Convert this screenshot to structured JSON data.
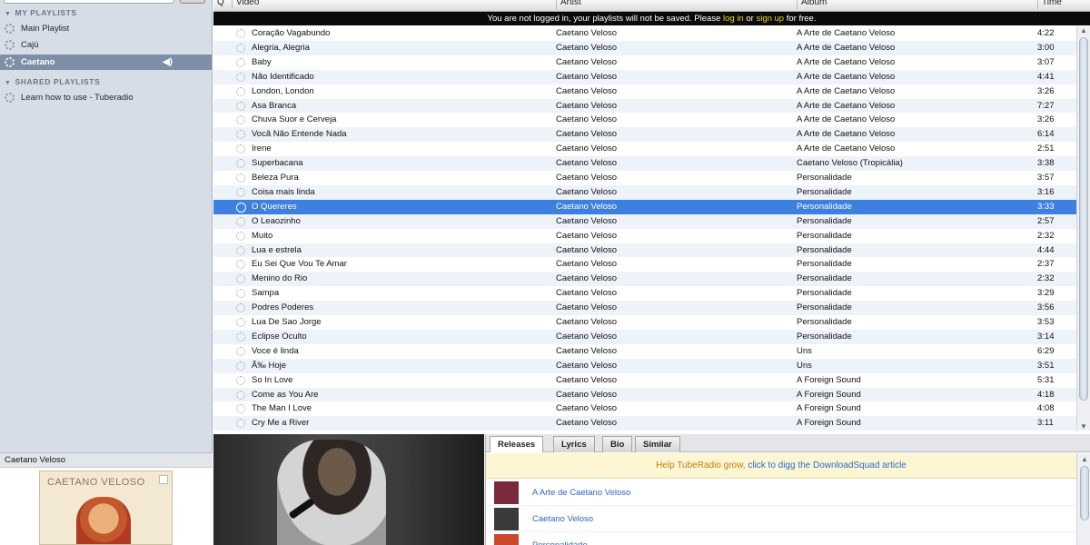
{
  "sidebar": {
    "sections": [
      {
        "label": "MY PLAYLISTS",
        "items": [
          {
            "label": "Main Playlist"
          },
          {
            "label": "Cajú"
          },
          {
            "label": "Caetano",
            "active": true
          }
        ]
      },
      {
        "label": "SHARED PLAYLISTS",
        "items": [
          {
            "label": "Learn how to use - Tuberadio"
          }
        ]
      }
    ]
  },
  "now_playing": {
    "artist": "Caetano Veloso",
    "cover_text": "CAETANO VELOSO"
  },
  "table": {
    "headers": {
      "queue": "Q",
      "video": "Video",
      "artist": "Artist",
      "album": "Album",
      "time": "Time"
    },
    "notice": {
      "prefix": "You are not logged in, your playlists will not be saved. Please ",
      "login": "log in",
      "or": " or ",
      "signup": "sign up",
      "suffix": " for free."
    },
    "rows": [
      {
        "title": "Coração Vagabundo",
        "artist": "Caetano Veloso",
        "album": "A Arte de Caetano Veloso",
        "time": "4:22"
      },
      {
        "title": "Alegria, Alegria",
        "artist": "Caetano Veloso",
        "album": "A Arte de Caetano Veloso",
        "time": "3:00"
      },
      {
        "title": "Baby",
        "artist": "Caetano Veloso",
        "album": "A Arte de Caetano Veloso",
        "time": "3:07"
      },
      {
        "title": "Não Identificado",
        "artist": "Caetano Veloso",
        "album": "A Arte de Caetano Veloso",
        "time": "4:41"
      },
      {
        "title": "London, London",
        "artist": "Caetano Veloso",
        "album": "A Arte de Caetano Veloso",
        "time": "3:26"
      },
      {
        "title": "Asa Branca",
        "artist": "Caetano Veloso",
        "album": "A Arte de Caetano Veloso",
        "time": "7:27"
      },
      {
        "title": "Chuva Suor e Cerveja",
        "artist": "Caetano Veloso",
        "album": "A Arte de Caetano Veloso",
        "time": "3:26"
      },
      {
        "title": "Vocã Não Entende Nada",
        "artist": "Caetano Veloso",
        "album": "A Arte de Caetano Veloso",
        "time": "6:14"
      },
      {
        "title": "Irene",
        "artist": "Caetano Veloso",
        "album": "A Arte de Caetano Veloso",
        "time": "2:51"
      },
      {
        "title": "Superbacana",
        "artist": "Caetano Veloso",
        "album": "Caetano Veloso (Tropicália)",
        "time": "3:38"
      },
      {
        "title": "Beleza Pura",
        "artist": "Caetano Veloso",
        "album": "Personalidade",
        "time": "3:57"
      },
      {
        "title": "Coisa mais linda",
        "artist": "Caetano Veloso",
        "album": "Personalidade",
        "time": "3:16"
      },
      {
        "title": "O Quereres",
        "artist": "Caetano Veloso",
        "album": "Personalidade",
        "time": "3:33",
        "selected": true
      },
      {
        "title": "O Leaozinho",
        "artist": "Caetano Veloso",
        "album": "Personalidade",
        "time": "2:57"
      },
      {
        "title": "Muito",
        "artist": "Caetano Veloso",
        "album": "Personalidade",
        "time": "2:32"
      },
      {
        "title": "Lua e estrela",
        "artist": "Caetano Veloso",
        "album": "Personalidade",
        "time": "4:44"
      },
      {
        "title": "Eu Sei Que Vou Te Amar",
        "artist": "Caetano Veloso",
        "album": "Personalidade",
        "time": "2:37"
      },
      {
        "title": "Menino do Rio",
        "artist": "Caetano Veloso",
        "album": "Personalidade",
        "time": "2:32"
      },
      {
        "title": "Sampa",
        "artist": "Caetano Veloso",
        "album": "Personalidade",
        "time": "3:29"
      },
      {
        "title": "Podres Poderes",
        "artist": "Caetano Veloso",
        "album": "Personalidade",
        "time": "3:56"
      },
      {
        "title": "Lua De Sao Jorge",
        "artist": "Caetano Veloso",
        "album": "Personalidade",
        "time": "3:53"
      },
      {
        "title": "Eclipse Oculto",
        "artist": "Caetano Veloso",
        "album": "Personalidade",
        "time": "3:14"
      },
      {
        "title": "Voce é linda",
        "artist": "Caetano Veloso",
        "album": "Uns",
        "time": "6:29"
      },
      {
        "title": "Ã‰ Hoje",
        "artist": "Caetano Veloso",
        "album": "Uns",
        "time": "3:51"
      },
      {
        "title": "So In Love",
        "artist": "Caetano Veloso",
        "album": "A Foreign Sound",
        "time": "5:31"
      },
      {
        "title": "Come as You Are",
        "artist": "Caetano Veloso",
        "album": "A Foreign Sound",
        "time": "4:18"
      },
      {
        "title": "The Man I Love",
        "artist": "Caetano Veloso",
        "album": "A Foreign Sound",
        "time": "4:08"
      },
      {
        "title": "Cry Me a River",
        "artist": "Caetano Veloso",
        "album": "A Foreign Sound",
        "time": "3:11"
      }
    ]
  },
  "info_panel": {
    "tabs": [
      "Releases",
      "Lyrics",
      "Bio",
      "Similar"
    ],
    "active_tab": "Releases",
    "banner": {
      "prefix": "Help TubeRadio grow, ",
      "link": "click to digg the DownloadSquad article"
    },
    "releases": [
      {
        "label": "A Arte de Caetano Veloso",
        "thumb_color": "#7a2a3c"
      },
      {
        "label": "Caetano Veloso",
        "thumb_color": "#3a3a3a"
      },
      {
        "label": "Personalidade",
        "thumb_color": "#c9492a"
      }
    ]
  },
  "colors": {
    "selection": "#3d80df",
    "link": "#2d63c8",
    "notice_link": "#f1d51b",
    "banner_text": "#c77b13"
  }
}
